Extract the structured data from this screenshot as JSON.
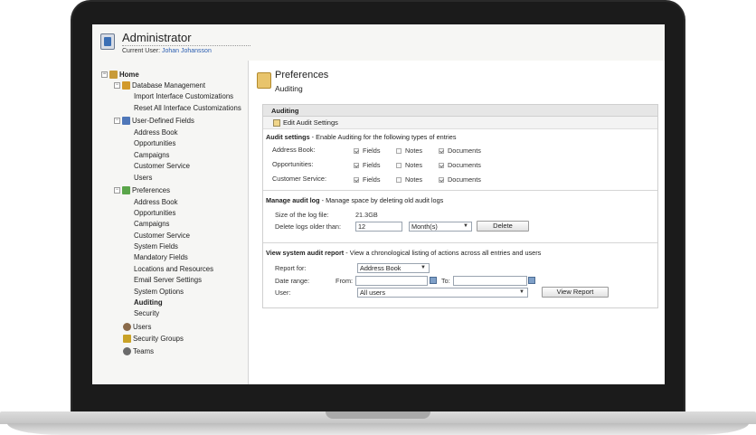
{
  "header": {
    "title": "Administrator",
    "user_label": "Current User:",
    "user_name": "Johan Johansson"
  },
  "sidebar": {
    "home": "Home",
    "database_management": "Database Management",
    "import_customizations": "Import Interface Customizations",
    "reset_customizations": "Reset All Interface Customizations",
    "user_defined_fields": "User-Defined Fields",
    "udf_items": [
      "Address Book",
      "Opportunities",
      "Campaigns",
      "Customer Service",
      "Users"
    ],
    "preferences": "Preferences",
    "pref_items": [
      "Address Book",
      "Opportunities",
      "Campaigns",
      "Customer Service",
      "System Fields",
      "Mandatory Fields",
      "Locations and Resources",
      "Email Server Settings",
      "System Options",
      "Auditing",
      "Security"
    ],
    "users": "Users",
    "security_groups": "Security Groups",
    "teams": "Teams"
  },
  "main": {
    "title": "Preferences",
    "subtitle": "Auditing",
    "panel_title": "Auditing",
    "edit_button": "Edit Audit Settings",
    "audit_settings": {
      "title": "Audit settings",
      "desc": " - Enable Auditing for the following types of entries",
      "rows": [
        {
          "label": "Address Book:",
          "fields": true,
          "notes": false,
          "documents": true
        },
        {
          "label": "Opportunities:",
          "fields": true,
          "notes": false,
          "documents": true
        },
        {
          "label": "Customer Service:",
          "fields": true,
          "notes": false,
          "documents": true
        }
      ],
      "col_fields": "Fields",
      "col_notes": "Notes",
      "col_documents": "Documents"
    },
    "manage_log": {
      "title": "Manage audit log",
      "desc": " - Manage space by deleting old audit logs",
      "size_label": "Size of the log file:",
      "size_value": "21.3GB",
      "delete_label": "Delete logs older than:",
      "delete_value": "12",
      "unit_value": "Month(s)",
      "delete_button": "Delete"
    },
    "report": {
      "title": "View system audit report",
      "desc": " - View a chronological listing of actions across all entries and users",
      "report_for_label": "Report for:",
      "report_for_value": "Address Book",
      "date_range_label": "Date range:",
      "from_label": "From:",
      "to_label": "To:",
      "user_label": "User:",
      "user_value": "All users",
      "view_button": "View Report"
    }
  }
}
